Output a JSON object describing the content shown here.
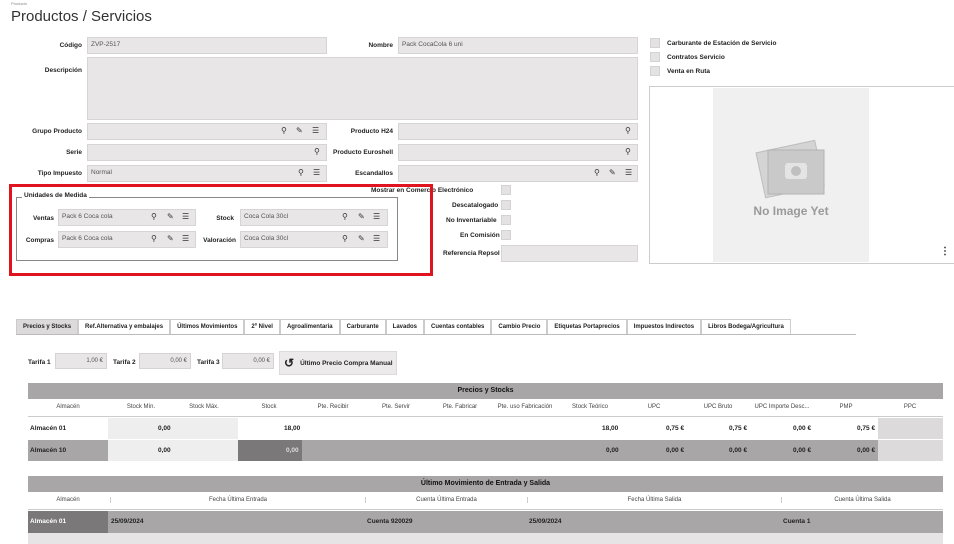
{
  "breadcrumb": "Producto",
  "title": "Productos / Servicios",
  "fields": {
    "codigo_label": "Código",
    "codigo_value": "ZVP-2517",
    "nombre_label": "Nombre",
    "nombre_value": "Pack CocaCola 6 uni",
    "descripcion_label": "Descripción",
    "grupo_label": "Grupo Producto",
    "producto_h24_label": "Producto H24",
    "serie_label": "Serie",
    "producto_euroshell_label": "Producto Euroshell",
    "tipo_impuesto_label": "Tipo Impuesto",
    "tipo_impuesto_value": "Normal",
    "escandallos_label": "Escandallos"
  },
  "checks": {
    "carburante": "Carburante de Estación de Servicio",
    "contratos": "Contratos Servicio",
    "venta_ruta": "Venta en Ruta",
    "mostrar": "Mostrar en Comercio Electrónico",
    "descatalogado": "Descatalogado",
    "no_inventariable": "No Inventariable",
    "en_comision": "En Comisión",
    "referencia_repsol": "Referencia Repsol"
  },
  "image_placeholder": "No Image Yet",
  "units": {
    "legend": "Unidades de Medida",
    "ventas_label": "Ventas",
    "ventas_value": "Pack 6 Coca cola",
    "compras_label": "Compras",
    "compras_value": "Pack 6 Coca cola",
    "stock_label": "Stock",
    "stock_value": "Coca Cola 30cl",
    "valoracion_label": "Valoración",
    "valoracion_value": "Coca Cola 30cl"
  },
  "tabs": [
    "Precios y Stocks",
    "Ref.Alternativa y embalajes",
    "Últimos Movimientos",
    "2º Nivel",
    "Agroalimentaria",
    "Carburante",
    "Lavados",
    "Cuentas contables",
    "Cambio Precio",
    "Etiquetas Portaprecios",
    "Impuestos Indirectos",
    "Libros Bodega/Agricultura"
  ],
  "tarifas": {
    "t1_label": "Tarifa 1",
    "t1_value": "1,00 €",
    "t2_label": "Tarifa 2",
    "t2_value": "0,00 €",
    "t3_label": "Tarifa 3",
    "t3_value": "0,00 €",
    "button": "Último Precio Compra Manual"
  },
  "stocks": {
    "title": "Precios y Stocks",
    "columns": [
      "Almacén",
      "Stock Mín.",
      "Stock Máx.",
      "Stock",
      "Pte. Recibir",
      "Pte. Servir",
      "Pte. Fabricar",
      "Pte. uso Fabricación",
      "Stock Teórico",
      "UPC",
      "UPC Bruto",
      "UPC Importe Desc...",
      "PMP",
      "PPC"
    ],
    "rows": [
      {
        "almacen": "Almacén 01",
        "min": "0,00",
        "stock": "18,00",
        "teorico": "18,00",
        "upc": "0,75 €",
        "upc_bruto": "0,75 €",
        "upc_desc": "0,00 €",
        "pmp": "0,75 €"
      },
      {
        "almacen": "Almacén 10",
        "min": "0,00",
        "stock": "0,00",
        "teorico": "0,00",
        "upc": "0,00 €",
        "upc_bruto": "0,00 €",
        "upc_desc": "0,00 €",
        "pmp": "0,00 €"
      }
    ]
  },
  "movs": {
    "title": "Último Movimiento de Entrada y Salida",
    "columns": [
      "Almacén",
      "Fecha Última Entrada",
      "Cuenta Última Entrada",
      "Fecha Última Salida",
      "Cuenta Última Salida"
    ],
    "row": {
      "almacen": "Almacén 01",
      "fecha_entrada": "25/09/2024",
      "cuenta_entrada": "Cuenta 920029",
      "fecha_salida": "25/09/2024",
      "cuenta_salida": "Cuenta 1"
    }
  }
}
